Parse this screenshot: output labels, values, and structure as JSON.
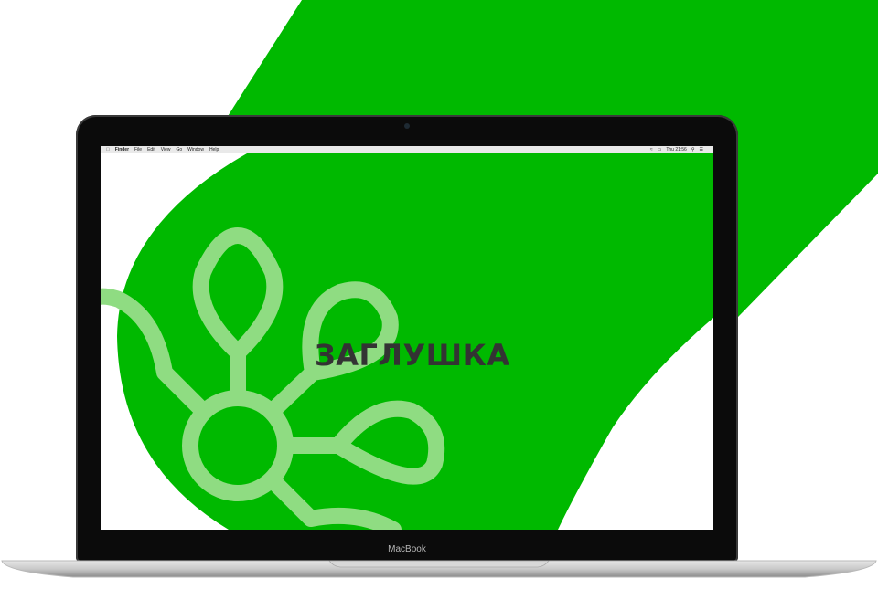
{
  "colors": {
    "brand_green": "#00b900",
    "light_green": "#8fdc82",
    "title_color": "#333333"
  },
  "menubar": {
    "apple_icon": "apple-logo-icon",
    "app_name": "Finder",
    "items": [
      "File",
      "Edit",
      "View",
      "Go",
      "Window",
      "Help"
    ],
    "clock": "Thu 21:56"
  },
  "desktop": {
    "title": "ЗАГЛУШКА"
  },
  "device": {
    "label": "MacBook"
  }
}
